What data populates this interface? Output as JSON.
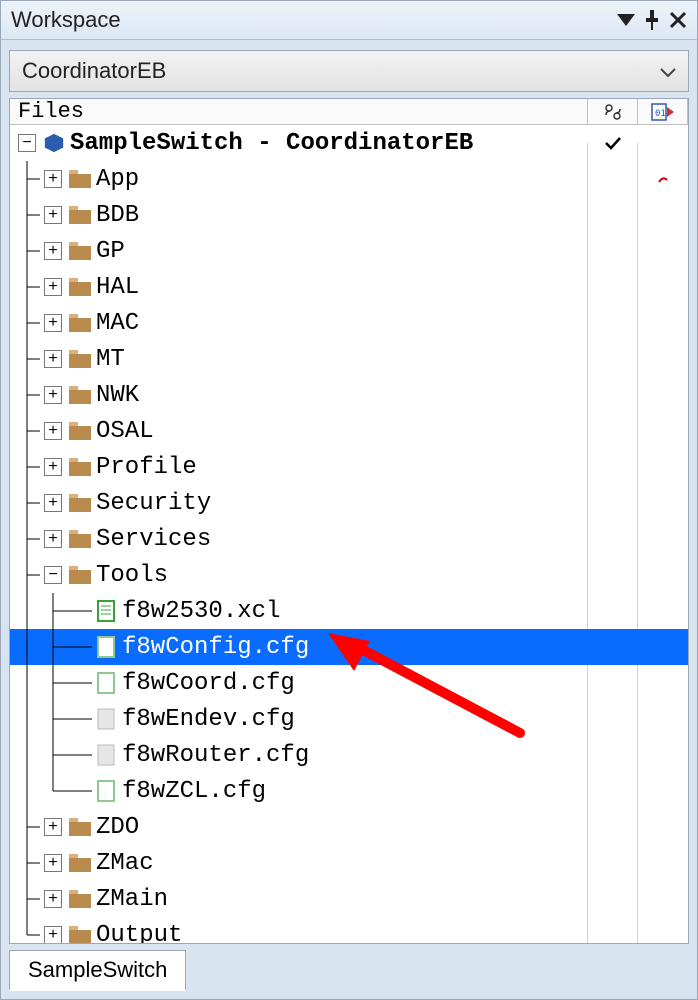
{
  "title": "Workspace",
  "dropdown": {
    "value": "CoordinatorEB"
  },
  "columns": {
    "files": "Files"
  },
  "project": {
    "label": "SampleSwitch - CoordinatorEB"
  },
  "folders": {
    "app": "App",
    "bdb": "BDB",
    "gp": "GP",
    "hal": "HAL",
    "mac": "MAC",
    "mt": "MT",
    "nwk": "NWK",
    "osal": "OSAL",
    "profile": "Profile",
    "security": "Security",
    "services": "Services",
    "tools": "Tools",
    "zdo": "ZDO",
    "zmac": "ZMac",
    "zmain": "ZMain",
    "output": "Output"
  },
  "files": {
    "f8w2530": "f8w2530.xcl",
    "f8wconfig": "f8wConfig.cfg",
    "f8wcoord": "f8wCoord.cfg",
    "f8wendev": "f8wEndev.cfg",
    "f8wrouter": "f8wRouter.cfg",
    "f8wzcl": "f8wZCL.cfg"
  },
  "tab": "SampleSwitch"
}
